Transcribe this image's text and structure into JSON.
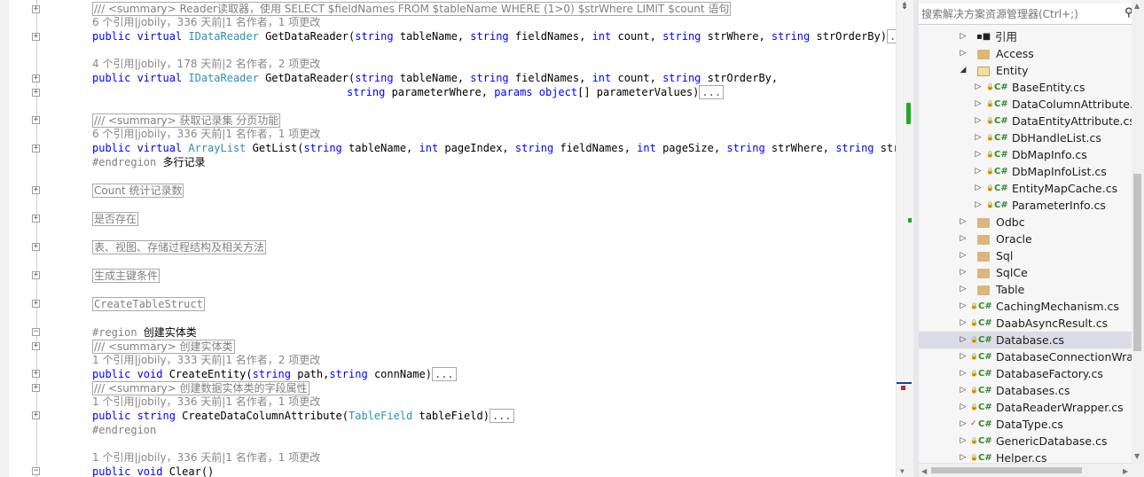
{
  "editor": {
    "lines": {
      "l1": "/// <summary> Reader读取器，使用 SELECT $fieldNames FROM $tableName WHERE (1>0) $strWhere LIMIT $count 语句",
      "l2_lens": "6 个引用|jobily，336 天前|1 名作者，1 项更改",
      "l3_kw1": "public virtual ",
      "l3_type": "IDataReader",
      "l3_rest_a": " GetDataReader(",
      "l3_kw2": "string",
      "l3_rest_b": " tableName, ",
      "l3_kw3": "string",
      "l3_rest_c": " fieldNames, ",
      "l3_kw4": "int",
      "l3_rest_d": " count, ",
      "l3_kw5": "string",
      "l3_rest_e": " strWhere, ",
      "l3_kw6": "string",
      "l3_rest_f": " strOrderBy)",
      "ellipsis": "...",
      "l5_lens": "4 个引用|jobily，178 天前|2 名作者，2 项更改",
      "l6_kw1": "public virtual ",
      "l6_type": "IDataReader",
      "l6_rest_a": " GetDataReader(",
      "l6_kw2": "string",
      "l6_rest_b": " tableName, ",
      "l6_kw3": "string",
      "l6_rest_c": " fieldNames, ",
      "l6_kw4": "int",
      "l6_rest_d": " count, ",
      "l6_kw5": "string",
      "l6_rest_e": " strOrderBy,",
      "l7_kw1": "string",
      "l7_rest_a": " parameterWhere, ",
      "l7_kw2": "params object",
      "l7_rest_b": "[] parameterValues)",
      "l9": "/// <summary> 获取记录集 分页功能",
      "l10_lens": "6 个引用|jobily，336 天前|1 名作者，1 项更改",
      "l11_kw1": "public virtual ",
      "l11_type": "ArrayList",
      "l11_rest_a": " GetList(",
      "l11_kw2": "string",
      "l11_rest_b": " tableName, ",
      "l11_kw3": "int",
      "l11_rest_c": " pageIndex, ",
      "l11_kw4": "string",
      "l11_rest_d": " fieldNames, ",
      "l11_kw5": "int",
      "l11_rest_e": " pageSize, ",
      "l11_kw6": "string",
      "l11_rest_f": " strWhere, ",
      "l11_kw7": "string",
      "l11_rest_g": " strOrde",
      "l12_a": "#endregion ",
      "l12_b": "多行记录",
      "region_count": "Count 统计记录数",
      "region_exists": "是否存在",
      "region_table": "表、视图、存储过程结构及相关方法",
      "region_pk": "生成主键条件",
      "region_create": "CreateTableStruct",
      "l18_a": "#region ",
      "l18_b": "创建实体类",
      "l19": "/// <summary> 创建实体类",
      "l20_lens": "1 个引用|jobily，333 天前|1 名作者，2 项更改",
      "l21_kw": "public void",
      "l21_rest_a": " CreateEntity(",
      "l21_kw2": "string",
      "l21_rest_b": " path,",
      "l21_kw3": "string",
      "l21_rest_c": " connName)",
      "l22": "/// <summary> 创建数据实体类的字段属性",
      "l23_lens": "1 个引用|jobily，336 天前|1 名作者，1 项更改",
      "l24_kw": "public string",
      "l24_rest_a": " CreateDataColumnAttribute(",
      "l24_type": "TableField",
      "l24_rest_b": " tableField)",
      "l25": "#endregion",
      "l27_lens": "1 个引用|jobily，336 天前|1 名作者，1 项更改",
      "l28_kw": "public void",
      "l28_rest": " Clear()"
    },
    "fold_plus": "+",
    "fold_minus": "−"
  },
  "scrollbar": {
    "split_icon": "split-icon"
  },
  "explorer": {
    "search": {
      "placeholder": "搜索解决方案资源管理器(Ctrl+;)"
    },
    "nodes": [
      {
        "label": "引用",
        "kind": "refs",
        "expand": "▷"
      },
      {
        "label": "Access",
        "kind": "folder",
        "expand": "▷"
      },
      {
        "label": "Entity",
        "kind": "folder-open",
        "expand": "◢"
      },
      {
        "label": "BaseEntity.cs",
        "kind": "cs"
      },
      {
        "label": "DataColumnAttribute.cs",
        "kind": "cs"
      },
      {
        "label": "DataEntityAttribute.cs",
        "kind": "cs"
      },
      {
        "label": "DbHandleList.cs",
        "kind": "cs"
      },
      {
        "label": "DbMapInfo.cs",
        "kind": "cs"
      },
      {
        "label": "DbMapInfoList.cs",
        "kind": "cs"
      },
      {
        "label": "EntityMapCache.cs",
        "kind": "cs"
      },
      {
        "label": "ParameterInfo.cs",
        "kind": "cs"
      },
      {
        "label": "Odbc",
        "kind": "folder"
      },
      {
        "label": "Oracle",
        "kind": "folder"
      },
      {
        "label": "Sql",
        "kind": "folder"
      },
      {
        "label": "SqlCe",
        "kind": "folder"
      },
      {
        "label": "Table",
        "kind": "folder"
      },
      {
        "label": "CachingMechanism.cs",
        "kind": "cs"
      },
      {
        "label": "DaabAsyncResult.cs",
        "kind": "cs"
      },
      {
        "label": "Database.cs",
        "kind": "cs",
        "selected": true
      },
      {
        "label": "DatabaseConnectionWrap",
        "kind": "cs"
      },
      {
        "label": "DatabaseFactory.cs",
        "kind": "cs"
      },
      {
        "label": "Databases.cs",
        "kind": "cs"
      },
      {
        "label": "DataReaderWrapper.cs",
        "kind": "cs"
      },
      {
        "label": "DataType.cs",
        "kind": "cs",
        "checked": true
      },
      {
        "label": "GenericDatabase.cs",
        "kind": "cs"
      },
      {
        "label": "Helper.cs",
        "kind": "cs"
      }
    ],
    "cs_glyph": "C#",
    "lock_glyph": "🔒",
    "check_glyph": "✓",
    "refs_glyph": "▪■",
    "tri_collapsed": "▷",
    "tri_expanded": "◢"
  },
  "colors": {
    "keyword": "#0000ff",
    "type": "#2b91af",
    "comment": "#808080",
    "selection": "#dcdce6",
    "cs_green": "#2e8b2e",
    "lock_blue": "#2b7ec1"
  }
}
